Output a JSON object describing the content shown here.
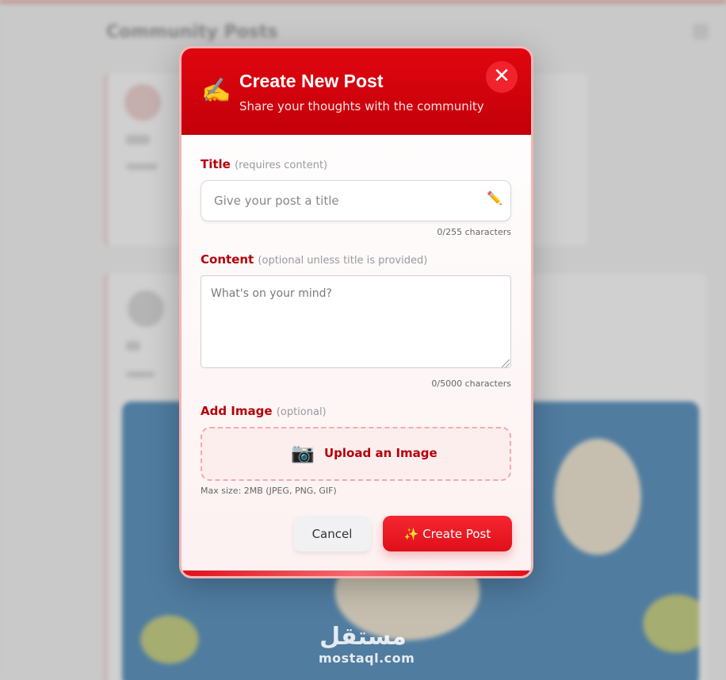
{
  "background": {
    "page_title": "Community Posts"
  },
  "modal": {
    "header": {
      "emoji": "✍️",
      "title": "Create New Post",
      "subtitle": "Share your thoughts with the community",
      "close_icon": "✕"
    },
    "title_field": {
      "label": "Title",
      "hint": "(requires content)",
      "placeholder": "Give your post a title",
      "value": "",
      "icon": "✏️",
      "counter": "0/255 characters"
    },
    "content_field": {
      "label": "Content",
      "hint": "(optional unless title is provided)",
      "placeholder": "What's on your mind?",
      "value": "",
      "counter": "0/5000 characters"
    },
    "image_field": {
      "label": "Add Image",
      "hint": "(optional)",
      "upload_icon": "📷",
      "upload_label": "Upload an Image",
      "max_size": "Max size: 2MB (JPEG, PNG, GIF)"
    },
    "actions": {
      "cancel_label": "Cancel",
      "create_label": "✨ Create Post"
    }
  },
  "watermark": {
    "arabic": "مستقل",
    "latin": "mostaql.com"
  },
  "colors": {
    "accent": "#e0060f",
    "label": "#b5000a",
    "hint": "#999aa3"
  }
}
